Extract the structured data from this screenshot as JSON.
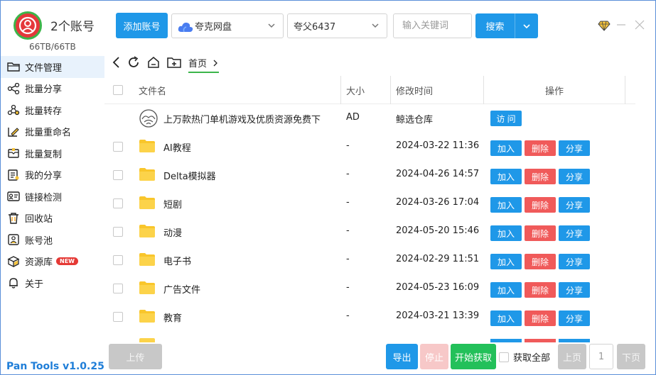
{
  "header": {
    "account_count_label": "2个账号",
    "storage": "66TB/66TB",
    "add_account_label": "添加账号",
    "disk_select": "夸克网盘",
    "account_select": "夸父6437",
    "search_placeholder": "输入关键词",
    "search_label": "搜索"
  },
  "sidebar": {
    "items": [
      {
        "label": "文件管理",
        "icon": "folder-icon"
      },
      {
        "label": "批量分享",
        "icon": "share-icon"
      },
      {
        "label": "批量转存",
        "icon": "transfer-icon"
      },
      {
        "label": "批量重命名",
        "icon": "rename-icon"
      },
      {
        "label": "批量复制",
        "icon": "copy-icon"
      },
      {
        "label": "我的分享",
        "icon": "my-share-icon"
      },
      {
        "label": "链接检测",
        "icon": "link-check-icon"
      },
      {
        "label": "回收站",
        "icon": "trash-icon"
      },
      {
        "label": "账号池",
        "icon": "account-pool-icon"
      },
      {
        "label": "资源库",
        "icon": "resource-icon",
        "badge": "NEW"
      },
      {
        "label": "关于",
        "icon": "bell-icon"
      }
    ],
    "version": "Pan Tools v1.0.25"
  },
  "breadcrumb": {
    "home": "首页"
  },
  "table": {
    "headers": {
      "name": "文件名",
      "size": "大小",
      "time": "修改时间",
      "actions": "操作"
    },
    "ad_row": {
      "name": "上万款热门单机游戏及优质资源免费下",
      "size": "AD",
      "time": "鲸选仓库",
      "action": "访 问"
    },
    "rows": [
      {
        "name": "AI教程",
        "size": "-",
        "time": "2024-03-22 11:36"
      },
      {
        "name": "Delta模拟器",
        "size": "-",
        "time": "2024-04-26 14:57"
      },
      {
        "name": "短剧",
        "size": "-",
        "time": "2024-03-26 17:04"
      },
      {
        "name": "动漫",
        "size": "-",
        "time": "2024-05-20 15:46"
      },
      {
        "name": "电子书",
        "size": "-",
        "time": "2024-02-29 11:51"
      },
      {
        "name": "广告文件",
        "size": "-",
        "time": "2024-05-23 16:09"
      },
      {
        "name": "教育",
        "size": "-",
        "time": "2024-03-21 13:39"
      }
    ],
    "action_labels": {
      "join": "加入",
      "delete": "删除",
      "share": "分享"
    }
  },
  "footer": {
    "upload": "上传",
    "export": "导出",
    "stop": "停止",
    "start_fetch": "开始获取",
    "fetch_all": "获取全部",
    "prev_page": "上页",
    "page_number": "1",
    "next_page": "下页"
  },
  "colors": {
    "accent": "#1f98e8",
    "danger": "#f05a5a",
    "success": "#23c05a",
    "brand_green": "#3cb54a"
  }
}
